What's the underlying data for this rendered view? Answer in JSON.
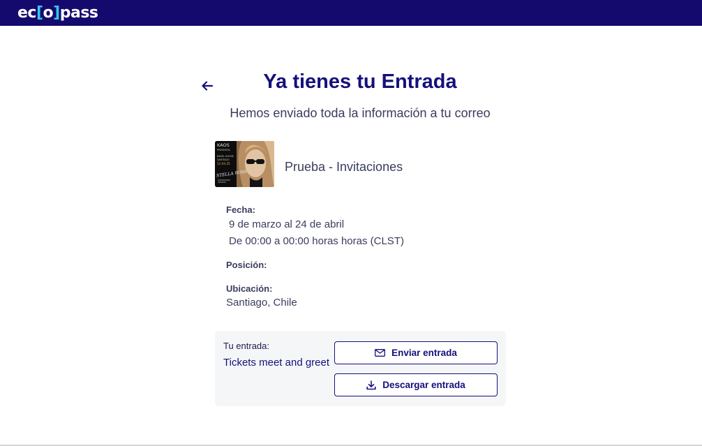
{
  "header": {
    "logo": {
      "left": "ec",
      "bracket_open": "[",
      "inner": "o",
      "bracket_close": "]",
      "right": "pass"
    }
  },
  "main": {
    "back_icon": "arrow-left-icon",
    "title": "Ya tienes tu Entrada",
    "subtitle": "Hemos enviado toda la información a tu correo"
  },
  "event": {
    "name": "Prueba - Invitaciones",
    "poster": {
      "brand": "KAOS",
      "presenta": "PRESENTA",
      "line1": "BASEL HOUSE",
      "line2": "SANTIAGO",
      "date": "12.04.25",
      "artist": "STELLA ROSS"
    }
  },
  "details": {
    "fecha_label": "Fecha:",
    "fecha_line1": "9 de marzo al 24 de abril",
    "fecha_line2": "De 00:00 a 00:00 horas horas (CLST)",
    "posicion_label": "Posición:",
    "ubicacion_label": "Ubicación:",
    "ubicacion_value": "Santiago, Chile"
  },
  "ticket": {
    "label": "Tu entrada:",
    "value": "Tickets meet and greet",
    "send_label": "Enviar entrada",
    "send_icon": "mail-icon",
    "download_label": "Descargar entrada",
    "download_icon": "download-icon"
  },
  "colors": {
    "topbar": "#140a6e",
    "accent": "#14107a",
    "logo_bracket": "#37c6e8",
    "text_muted": "#3a3d5c",
    "panel_bg": "#f5f6f8"
  }
}
